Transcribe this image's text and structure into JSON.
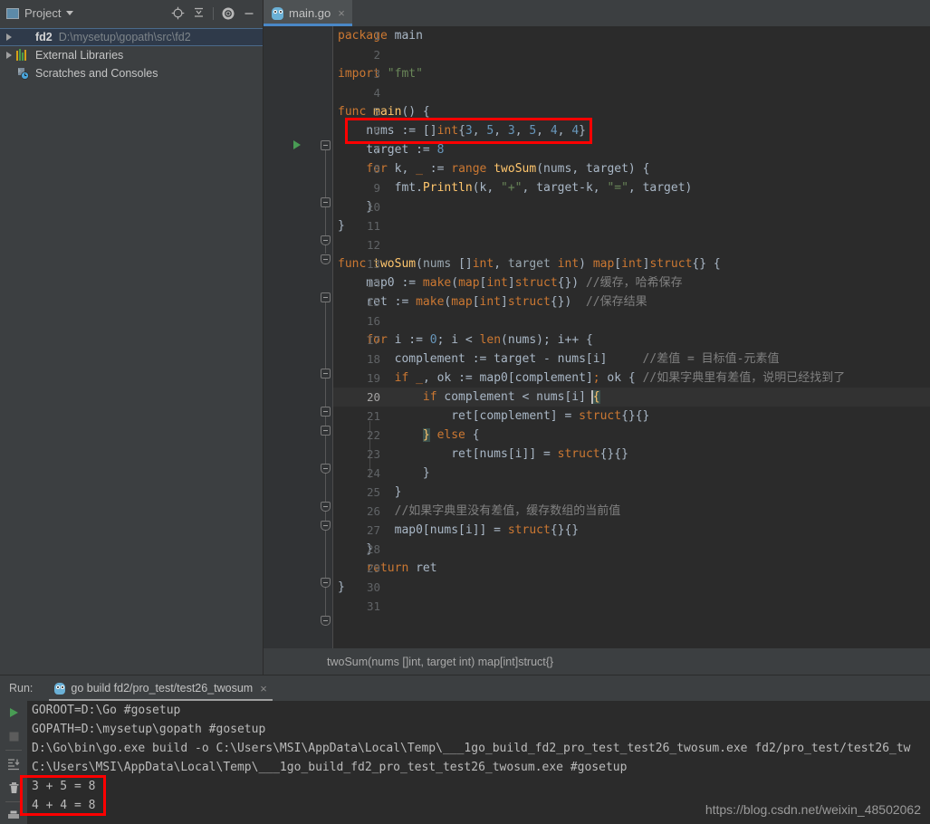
{
  "project_panel": {
    "title": "Project",
    "icon": "project-icon",
    "tools": [
      {
        "name": "locate-target-icon",
        "label": "Select Opened File"
      },
      {
        "name": "collapse-all-icon",
        "label": "Collapse All"
      },
      {
        "name": "gear-icon",
        "label": "Settings"
      },
      {
        "name": "minimize-icon",
        "label": "Hide"
      }
    ],
    "tree": [
      {
        "label": "fd2",
        "sub": "D:\\mysetup\\gopath\\src\\fd2",
        "icon": "folder-icon",
        "expandable": true,
        "selected": true,
        "bold": true
      },
      {
        "label": "External Libraries",
        "sub": "",
        "icon": "libraries-icon",
        "expandable": true,
        "selected": false,
        "bold": false
      },
      {
        "label": "Scratches and Consoles",
        "sub": "",
        "icon": "scratches-icon",
        "expandable": false,
        "selected": false,
        "bold": false
      }
    ]
  },
  "editor": {
    "tab": {
      "label": "main.go",
      "icon": "go-file-icon",
      "close": "×",
      "active": true
    },
    "current_line": 20,
    "run_arrow_line": 5,
    "breadcrumb": "twoSum(nums []int, target int) map[int]struct{}",
    "lines": [
      {
        "n": 1,
        "code": "package main"
      },
      {
        "n": 2,
        "code": ""
      },
      {
        "n": 3,
        "code": "import \"fmt\""
      },
      {
        "n": 4,
        "code": ""
      },
      {
        "n": 5,
        "code": "func main() {"
      },
      {
        "n": 6,
        "code": "    nums := []int{3, 5, 3, 5, 4, 4}"
      },
      {
        "n": 7,
        "code": "    target := 8"
      },
      {
        "n": 8,
        "code": "    for k, _ := range twoSum(nums, target) {"
      },
      {
        "n": 9,
        "code": "        fmt.Println(k, \"+\", target-k, \"=\", target)"
      },
      {
        "n": 10,
        "code": "    }"
      },
      {
        "n": 11,
        "code": "}"
      },
      {
        "n": 12,
        "code": ""
      },
      {
        "n": 13,
        "code": "func twoSum(nums []int, target int) map[int]struct{} {"
      },
      {
        "n": 14,
        "code": "    map0 := make(map[int]struct{}) //缓存，哈希保存"
      },
      {
        "n": 15,
        "code": "    ret := make(map[int]struct{})  //保存结果"
      },
      {
        "n": 16,
        "code": ""
      },
      {
        "n": 17,
        "code": "    for i := 0; i < len(nums); i++ {"
      },
      {
        "n": 18,
        "code": "        complement := target - nums[i]     //差值 = 目标值-元素值"
      },
      {
        "n": 19,
        "code": "        if _, ok := map0[complement]; ok { //如果字典里有差值，说明已经找到了"
      },
      {
        "n": 20,
        "code": "            if complement < nums[i] {"
      },
      {
        "n": 21,
        "code": "                ret[complement] = struct{}{}"
      },
      {
        "n": 22,
        "code": "            } else {"
      },
      {
        "n": 23,
        "code": "                ret[nums[i]] = struct{}{}"
      },
      {
        "n": 24,
        "code": "            }"
      },
      {
        "n": 25,
        "code": "        }"
      },
      {
        "n": 26,
        "code": "        //如果字典里没有差值，缓存数组的当前值"
      },
      {
        "n": 27,
        "code": "        map0[nums[i]] = struct{}{}"
      },
      {
        "n": 28,
        "code": "    }"
      },
      {
        "n": 29,
        "code": "    return ret"
      },
      {
        "n": 30,
        "code": "}"
      },
      {
        "n": 31,
        "code": ""
      }
    ]
  },
  "run_panel": {
    "label": "Run:",
    "tab": {
      "label": "go build fd2/pro_test/test26_twosum",
      "icon": "go-run-icon",
      "close": "×"
    },
    "tools": [
      {
        "name": "rerun-icon",
        "label": "Rerun"
      },
      {
        "name": "stop-icon",
        "label": "Stop"
      },
      {
        "name": "scroll-to-end-icon",
        "label": "Scroll to End"
      },
      {
        "name": "trash-icon",
        "label": "Clear All"
      },
      {
        "name": "print-icon",
        "label": "Print"
      }
    ],
    "console": [
      "GOROOT=D:\\Go #gosetup",
      "GOPATH=D:\\mysetup\\gopath #gosetup",
      "D:\\Go\\bin\\go.exe build -o C:\\Users\\MSI\\AppData\\Local\\Temp\\___1go_build_fd2_pro_test_test26_twosum.exe fd2/pro_test/test26_tw",
      "C:\\Users\\MSI\\AppData\\Local\\Temp\\___1go_build_fd2_pro_test_test26_twosum.exe #gosetup",
      "3 + 5 = 8",
      "4 + 4 = 8"
    ]
  },
  "watermark": "https://blog.csdn.net/weixin_48502062",
  "colors": {
    "accent_blue": "#4a88c7",
    "annotation_red": "#ff0000",
    "keyword": "#cc7832",
    "function": "#ffc66d",
    "number": "#6897bb",
    "string": "#6a8759",
    "comment": "#808080",
    "editor_bg": "#2b2b2b",
    "chrome_bg": "#3c3f41"
  }
}
